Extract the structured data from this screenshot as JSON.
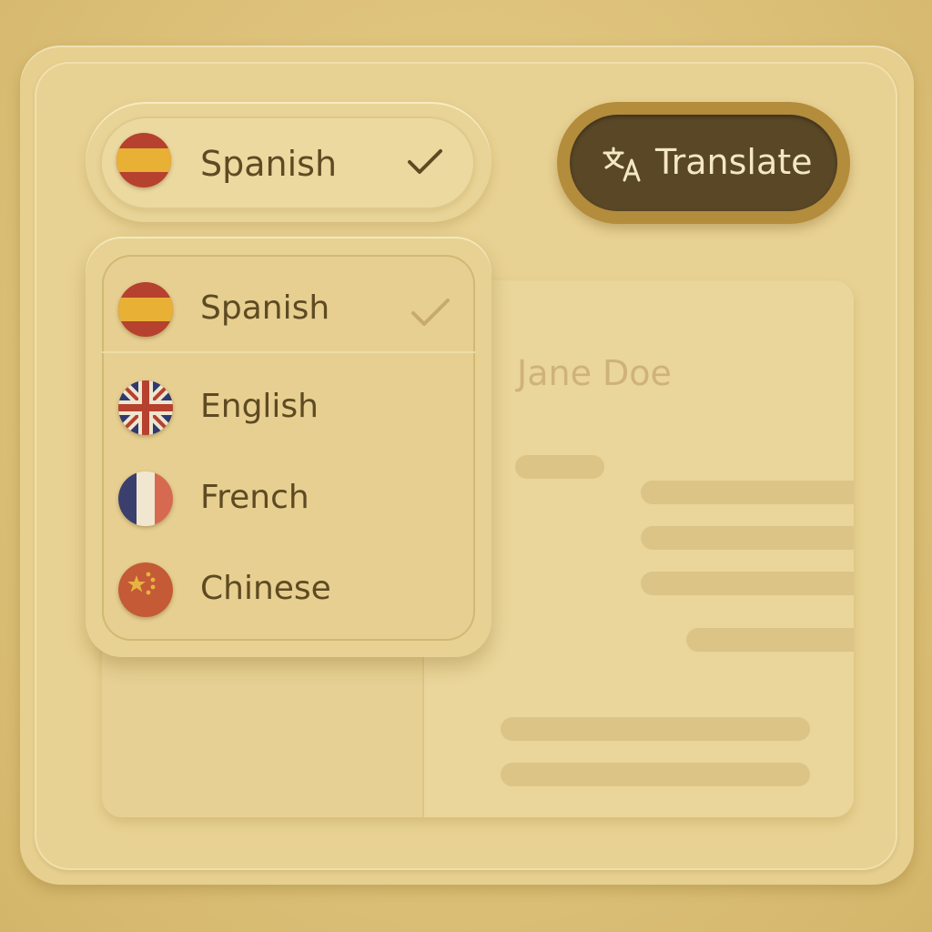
{
  "selector": {
    "selected_label": "Spanish",
    "flag_icon": "spain-flag-icon",
    "check_icon": "checkmark-icon"
  },
  "translate_button": {
    "label": "Translate",
    "icon": "translate-icon"
  },
  "dropdown": {
    "options": [
      {
        "label": "Spanish",
        "flag_icon": "spain-flag-icon",
        "selected": true
      },
      {
        "label": "English",
        "flag_icon": "uk-flag-icon",
        "selected": false
      },
      {
        "label": "French",
        "flag_icon": "france-flag-icon",
        "selected": false
      },
      {
        "label": "Chinese",
        "flag_icon": "china-flag-icon",
        "selected": false
      }
    ]
  },
  "document": {
    "name": "Jane Doe"
  },
  "colors": {
    "background": "#dcc078",
    "panel": "#e8d293",
    "button_dark": "#594726",
    "text": "#5e4a22",
    "accent_ring": "#b38c3c"
  }
}
